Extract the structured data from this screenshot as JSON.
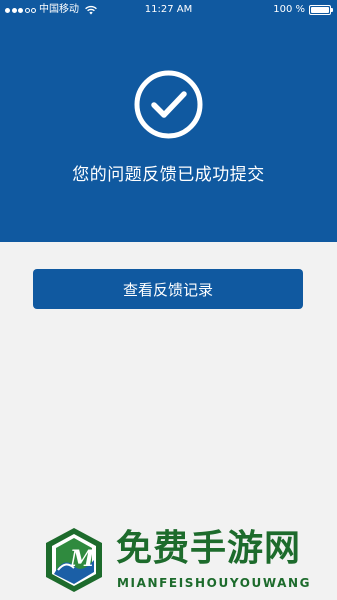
{
  "status_bar": {
    "carrier": "中国移动",
    "time": "11:27 AM",
    "battery_percent": "100 %",
    "signal_bars_filled": 3,
    "signal_bars_total": 5
  },
  "header": {
    "icon": "check-circle-icon",
    "message": "您的问题反馈已成功提交"
  },
  "actions": {
    "view_records_label": "查看反馈记录"
  },
  "watermark": {
    "title": "免费手游网",
    "subtitle": "MIANFEISHOUYOUWANG"
  },
  "colors": {
    "primary": "#1059a0",
    "background": "#f2f2f2",
    "watermark_green": "#1d6b2c"
  }
}
